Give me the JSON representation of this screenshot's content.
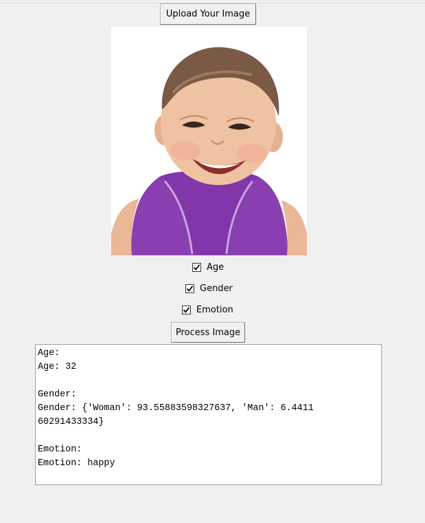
{
  "toolbar": {
    "upload_label": "Upload Your Image",
    "process_label": "Process Image"
  },
  "options": [
    {
      "label": "Age",
      "checked": true
    },
    {
      "label": "Gender",
      "checked": true
    },
    {
      "label": "Emotion",
      "checked": true
    }
  ],
  "output": {
    "lines": [
      "Age:",
      "Age: 32",
      "",
      "Gender:",
      "Gender: {'Woman': 93.55883598327637, 'Man': 6.4411",
      "60291433334}",
      "",
      "Emotion:",
      "Emotion: happy"
    ]
  },
  "colors": {
    "window_bg": "#f0f0f0",
    "text_area_bg": "#ffffff",
    "shirt": "#8a3fb1"
  }
}
